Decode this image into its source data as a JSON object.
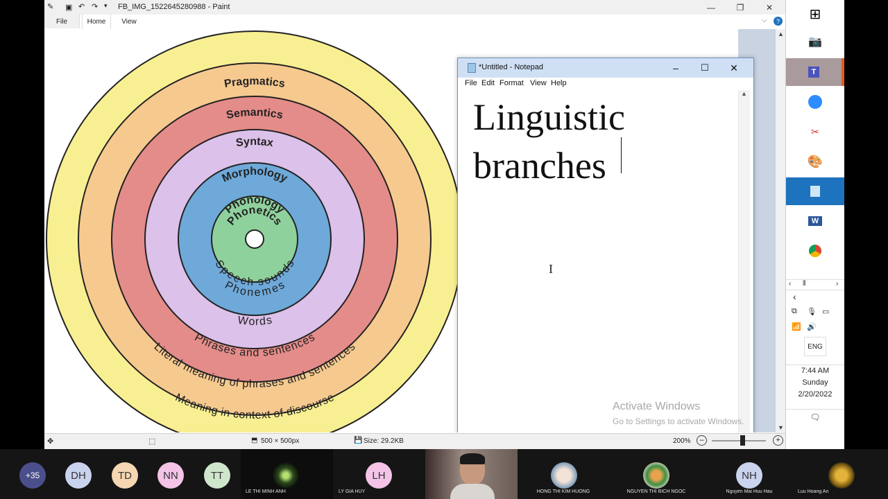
{
  "paint": {
    "title": "FB_IMG_1522645280988 - Paint",
    "menu": [
      "File",
      "Home",
      "View"
    ],
    "status": {
      "dimensions": "500 × 500px",
      "size": "Size: 29.2KB",
      "zoom": "200%"
    }
  },
  "diagram": {
    "rings": [
      {
        "label": "Pragmatics",
        "color": "#f8ef92"
      },
      {
        "label": "Semantics",
        "color": "#f6c98f"
      },
      {
        "label": "Syntax",
        "color": "#e48c89"
      },
      {
        "label": "Morphology",
        "color": "#dcc1ea"
      },
      {
        "label": "Phonology",
        "color": "#6ea9d9"
      },
      {
        "label": "Phonetics",
        "color": "#8fd19c"
      }
    ],
    "inner_labels": {
      "speech_sounds": "Speech sounds",
      "phonemes": "Phonemes",
      "words": "Words",
      "phrases": "Phrases and sentences",
      "literal": "Literal meaning of phrases and sentences",
      "context": "Meaning in context of discourse"
    }
  },
  "notepad": {
    "title": "*Untitled - Notepad",
    "menu": [
      "File",
      "Edit",
      "Format",
      "View",
      "Help"
    ],
    "text": "Linguistic\nbranches"
  },
  "watermark": {
    "line1": "Activate Windows",
    "line2": "Go to Settings to activate Windows."
  },
  "tray": {
    "time": "7:44 AM",
    "day": "Sunday",
    "date": "2/20/2022",
    "lang": "ENG"
  },
  "participants": [
    {
      "initials": "+35",
      "color": "#4a4f8c"
    },
    {
      "initials": "DH",
      "color": "#c9d3ee"
    },
    {
      "initials": "TD",
      "color": "#f6d7b2"
    },
    {
      "initials": "NN",
      "color": "#f3c4e7"
    },
    {
      "initials": "TT",
      "color": "#cfe6cd"
    },
    {
      "initials": "",
      "name": "LE THI MINH ANH"
    },
    {
      "initials": "LH",
      "name": "LY GIA HUY",
      "color": "#f3c4e7"
    },
    {
      "initials": "",
      "name": ""
    },
    {
      "initials": "",
      "name": "HONG THI KIM HUONG"
    },
    {
      "initials": "",
      "name": "NGUYEN THI BICH NGOC"
    },
    {
      "initials": "NH",
      "name": "Nguyen Mai Huu Hau",
      "color": "#c9d3ee"
    },
    {
      "initials": "",
      "name": "Luu Hoang An"
    }
  ]
}
